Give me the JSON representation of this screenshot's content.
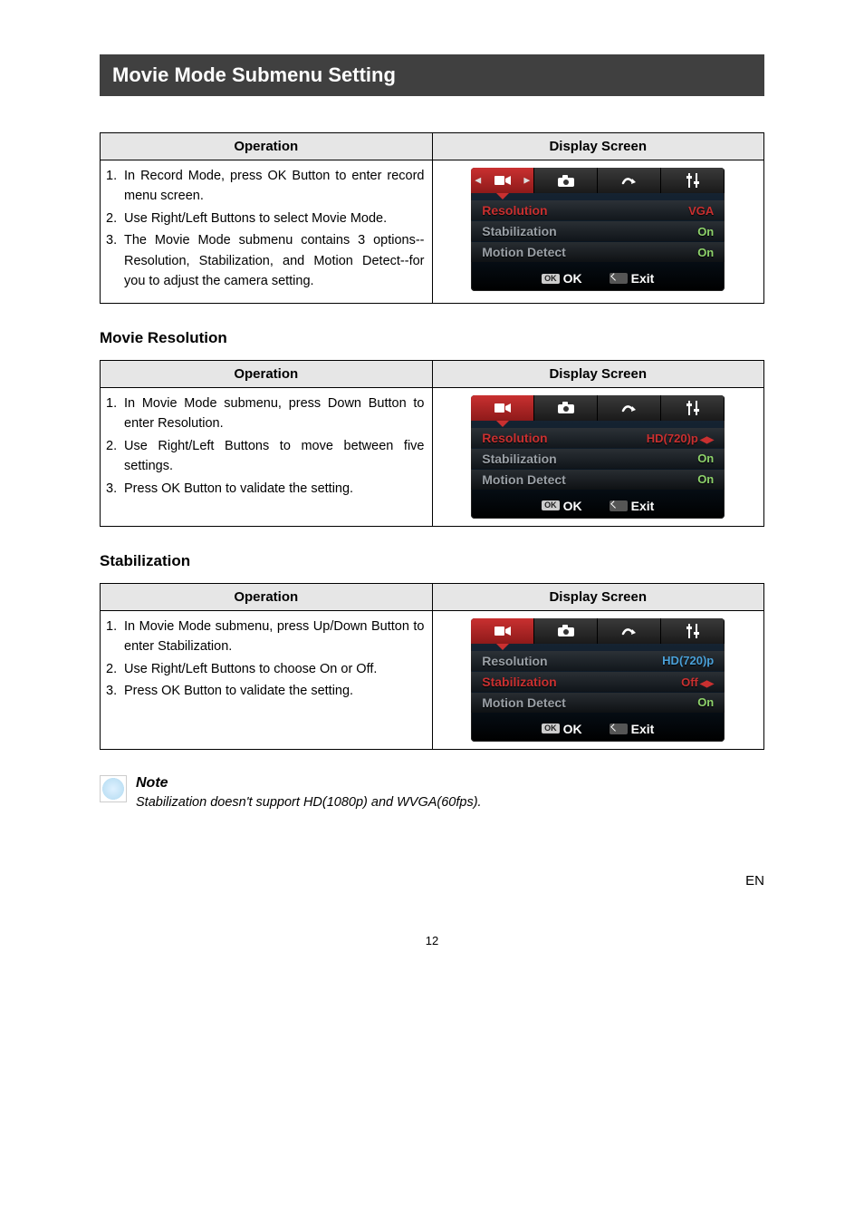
{
  "h1": "Movie Mode Submenu Setting",
  "headers": {
    "operation": "Operation",
    "display_screen": "Display Screen"
  },
  "table1": {
    "ops": [
      "In Record Mode, press OK Button to enter record menu screen.",
      "Use Right/Left Buttons to select Movie Mode.",
      "The Movie Mode submenu contains 3 options--Resolution, Stabilization, and Motion Detect--for you to adjust the camera setting."
    ],
    "screen": {
      "rows": [
        {
          "label": "Resolution",
          "value": "VGA",
          "selected": true
        },
        {
          "label": "Stabilization",
          "value": "On",
          "selected": false
        },
        {
          "label": "Motion Detect",
          "value": "On",
          "selected": false
        }
      ],
      "ok": "OK",
      "exit": "Exit",
      "show_side_arrows": true
    }
  },
  "sec2_title": "Movie Resolution",
  "table2": {
    "ops": [
      "In Movie Mode submenu, press Down Button to enter Resolution.",
      "Use Right/Left Buttons to move between five settings.",
      "Press OK Button to validate the setting."
    ],
    "screen": {
      "rows": [
        {
          "label": "Resolution",
          "value": "HD(720)p",
          "selected": true,
          "arrows": true
        },
        {
          "label": "Stabilization",
          "value": "On",
          "selected": false
        },
        {
          "label": "Motion Detect",
          "value": "On",
          "selected": false
        }
      ],
      "ok": "OK",
      "exit": "Exit",
      "show_side_arrows": false
    }
  },
  "sec3_title": "Stabilization",
  "table3": {
    "ops": [
      "In Movie Mode submenu, press Up/Down Button to enter Stabilization.",
      "Use Right/Left Buttons to choose On or Off.",
      "Press OK Button to validate the setting."
    ],
    "screen": {
      "rows": [
        {
          "label": "Resolution",
          "value": "HD(720)p",
          "selected": false,
          "valcolor": "blue"
        },
        {
          "label": "Stabilization",
          "value": "Off",
          "selected": true,
          "arrows": true
        },
        {
          "label": "Motion Detect",
          "value": "On",
          "selected": false
        }
      ],
      "ok": "OK",
      "exit": "Exit",
      "show_side_arrows": false
    }
  },
  "note_title": "Note",
  "note_text": "Stabilization doesn't support HD(1080p) and WVGA(60fps).",
  "footer_lang": "EN",
  "page_num": "12"
}
